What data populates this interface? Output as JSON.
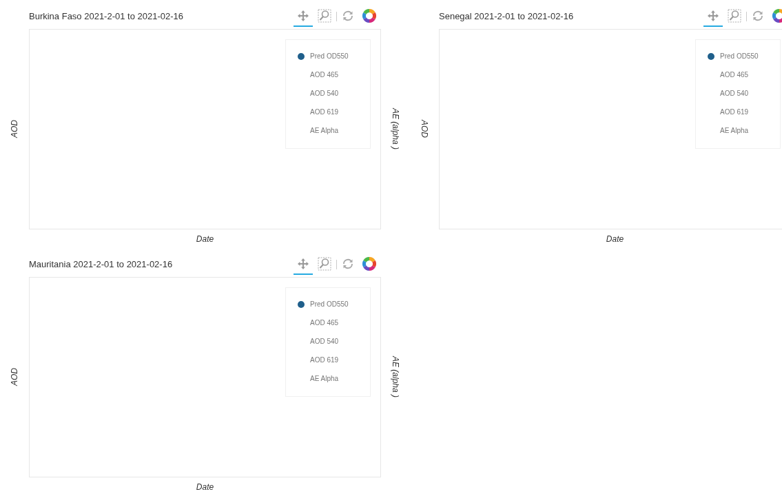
{
  "panels": [
    {
      "title": "Burkina Faso 2021-2-01 to 2021-02-16",
      "y_label": "AOD",
      "y_label_reads_down": false,
      "y2_label": "AE (alpha )",
      "x_label": "Date",
      "tools": [
        {
          "kind": "pan",
          "selected": true
        },
        {
          "kind": "box_zoom",
          "selected": false
        },
        {
          "kind": "reset",
          "selected": false
        },
        {
          "kind": "logo",
          "selected": false
        }
      ],
      "legend": [
        {
          "label": "Pred OD550",
          "color": "#1f5f8b"
        },
        {
          "label": "AOD 465"
        },
        {
          "label": "AOD 540"
        },
        {
          "label": "AOD 619"
        },
        {
          "label": "AE Alpha"
        }
      ]
    },
    {
      "title": "Senegal 2021-2-01 to 2021-02-16",
      "y_label": "AOD",
      "y_label_reads_down": true,
      "x_label": "Date",
      "tools": [
        {
          "kind": "pan",
          "selected": true
        },
        {
          "kind": "box_zoom",
          "selected": false
        },
        {
          "kind": "reset",
          "selected": false
        },
        {
          "kind": "logo",
          "selected": false
        }
      ],
      "legend": [
        {
          "label": "Pred OD550",
          "color": "#1f5f8b"
        },
        {
          "label": "AOD 465"
        },
        {
          "label": "AOD 540"
        },
        {
          "label": "AOD 619"
        },
        {
          "label": "AE Alpha"
        }
      ]
    },
    {
      "title": "Mauritania 2021-2-01 to 2021-02-16",
      "y_label": "AOD",
      "y_label_reads_down": false,
      "y2_label": "AE (alpha )",
      "x_label": "Date",
      "tools": [
        {
          "kind": "pan",
          "selected": true
        },
        {
          "kind": "box_zoom",
          "selected": false
        },
        {
          "kind": "reset",
          "selected": false
        },
        {
          "kind": "logo",
          "selected": false
        }
      ],
      "legend": [
        {
          "label": "Pred OD550",
          "color": "#1f5f8b"
        },
        {
          "label": "AOD 465"
        },
        {
          "label": "AOD 540"
        },
        {
          "label": "AOD 619"
        },
        {
          "label": "AE Alpha"
        }
      ]
    }
  ]
}
